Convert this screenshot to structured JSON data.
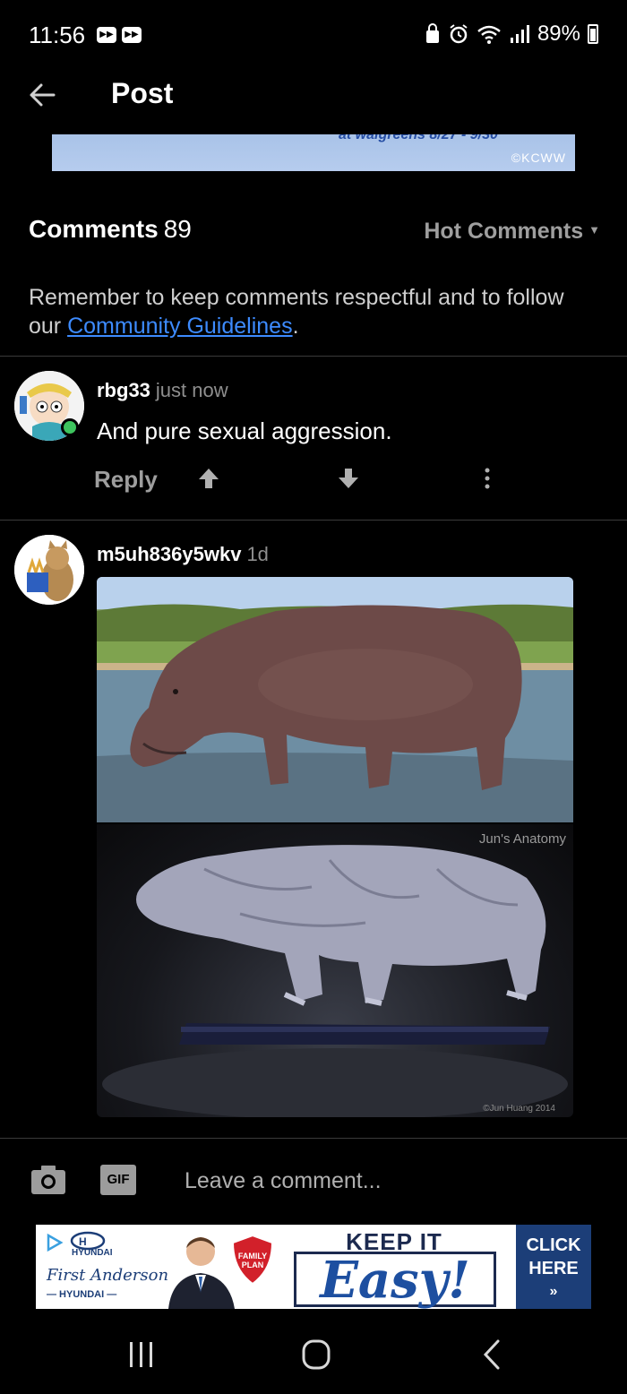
{
  "status_bar": {
    "time": "11:56",
    "battery_text": "89%",
    "icons": [
      "media-icon",
      "media-icon",
      "vpn-icon",
      "alarm-icon",
      "wifi-icon",
      "signal-icon",
      "battery-icon"
    ]
  },
  "header": {
    "title": "Post",
    "back_icon": "arrow-left-icon"
  },
  "banner_image": {
    "visible_text": "at walgreens 8/27 - 9/30",
    "credit": "©KCWW"
  },
  "comments": {
    "label": "Comments",
    "count": "89",
    "sort_label": "Hot Comments",
    "guidelines_text": "Remember to keep comments respectful and to follow our ",
    "guidelines_link": "Community Guidelines",
    "guidelines_end": "."
  },
  "comment_list": [
    {
      "username": "rbg33",
      "time": "just now",
      "text": "And pure sexual aggression.",
      "reply_label": "Reply",
      "online": true
    },
    {
      "username": "m5uh836y5wkv",
      "time": "1d",
      "image_watermark": "Jun's Anatomy",
      "image_credit": "©Jun Huang 2014"
    }
  ],
  "composer": {
    "placeholder": "Leave a comment...",
    "gif_label": "GIF"
  },
  "ad": {
    "brand": "HYUNDAI",
    "script": "First Anderson",
    "sub": "— HYUNDAI —",
    "shield_text": "FAMILY PLAN",
    "headline_top": "KEEP IT",
    "headline_main": "Easy!",
    "cta": "CLICK HERE",
    "cta_arrow": "»"
  },
  "colors": {
    "background": "#000000",
    "link": "#3d8bff",
    "muted": "#9e9e9e",
    "online": "#3ec45e"
  }
}
